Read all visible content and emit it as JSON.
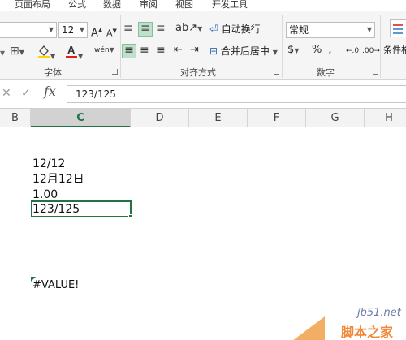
{
  "ribbon": {
    "tabs": [
      "页面布局",
      "公式",
      "数据",
      "审阅",
      "视图",
      "开发工具"
    ],
    "font_size": "12",
    "grow_font": "A",
    "shrink_font": "A",
    "phonetic_glyph": "wén",
    "wrap_text": "自动换行",
    "merge_center": "合并后居中",
    "number_format": "常规",
    "percent": "%",
    "comma": ",",
    "inc_decimal": ".0",
    "dec_decimal": ".00",
    "conditional_format": "条件格式",
    "groups": {
      "font": "字体",
      "alignment": "对齐方式",
      "number": "数字"
    },
    "font_color": "#e02020",
    "fill_color": "#ffd400"
  },
  "formula_bar": {
    "cancel": "✕",
    "enter": "✓",
    "fx": "fx",
    "value": "123/125"
  },
  "grid": {
    "columns": [
      "B",
      "C",
      "D",
      "E",
      "F",
      "G",
      "H"
    ],
    "active_column": "C",
    "cells": [
      "12/12",
      "12月12日",
      "1.00",
      "123/125",
      "#VALUE!"
    ],
    "selection_color": "#217346"
  },
  "watermark": {
    "site": "jb51.net",
    "name": "脚本之家"
  }
}
